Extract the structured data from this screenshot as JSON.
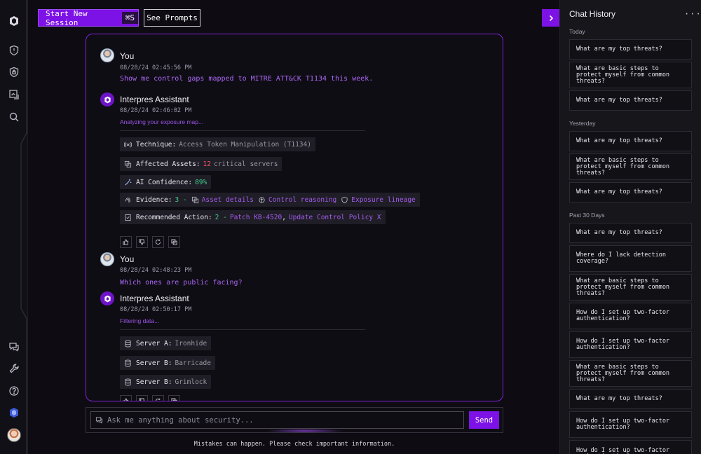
{
  "toolbar": {
    "new_session_label": "Start New Session",
    "new_session_shortcut": "⌘S",
    "see_prompts_label": "See Prompts"
  },
  "conversation": {
    "msg1": {
      "author": "You",
      "timestamp": "08/28/24 02:45:56 PM",
      "text": "Show me control gaps mapped to MITRE ATT&CK T1134 this week."
    },
    "msg2": {
      "author": "Interpres Assistant",
      "timestamp": "08/28/24 02:46:02 PM",
      "status": "Analyzing your exposure map...",
      "technique_label": "Technique:",
      "technique_value": "Access Token Manipulation (T1134)",
      "assets_label": "Affected Assets:",
      "assets_count": "12",
      "assets_suffix": "critical servers",
      "confidence_label": "AI Confidence:",
      "confidence_value": "89%",
      "evidence_label": "Evidence:",
      "evidence_count": "3 -",
      "evidence_link1": "Asset details",
      "evidence_link2": "Control reasoning",
      "evidence_link3": "Exposure lineage",
      "action_label": "Recommended Action:",
      "action_count": "2 -",
      "action_link1": "Patch KB-4520",
      "action_sep": ",",
      "action_link2": "Update Control Policy X"
    },
    "msg3": {
      "author": "You",
      "timestamp": "08/28/24 02:48:23 PM",
      "text": "Which ones are public facing?"
    },
    "msg4": {
      "author": "Interpres Assistant",
      "timestamp": "08/28/24 02:50:17 PM",
      "status": "Filtering data...",
      "servers": [
        {
          "label": "Server A:",
          "value": "Ironhide"
        },
        {
          "label": "Server B:",
          "value": "Barricade"
        },
        {
          "label": "Server B:",
          "value": "Grimlock"
        }
      ]
    }
  },
  "input": {
    "placeholder": "Ask me anything about security...",
    "send_label": "Send",
    "disclaimer": "Mistakes can happen. Please check important information."
  },
  "history": {
    "title": "Chat History",
    "more": "···",
    "sections": [
      {
        "label": "Today",
        "items": [
          "What are my top threats?",
          "What are basic steps to protect myself from common threats?",
          "What are my top threats?"
        ]
      },
      {
        "label": "Yesterday",
        "items": [
          "What are my top threats?",
          "What are basic steps to protect myself from common threats?",
          "What are my top threats?"
        ]
      },
      {
        "label": "Past 30 Days",
        "items": [
          "What are my top threats?",
          "Where do I lack detection coverage?",
          "What are basic steps to protect myself from common threats?",
          "How do I set up two-factor authentication?",
          "How do I set up two-factor authentication?",
          "What are basic steps to protect myself from common threats?",
          "What are my top threats?",
          "How do I set up two-factor authentication?",
          "How do I set up two-factor authentication?"
        ]
      }
    ]
  },
  "colors": {
    "accent": "#7d12e6",
    "link": "#a45cf0",
    "danger": "#f0556a",
    "success": "#3fcf8e"
  }
}
